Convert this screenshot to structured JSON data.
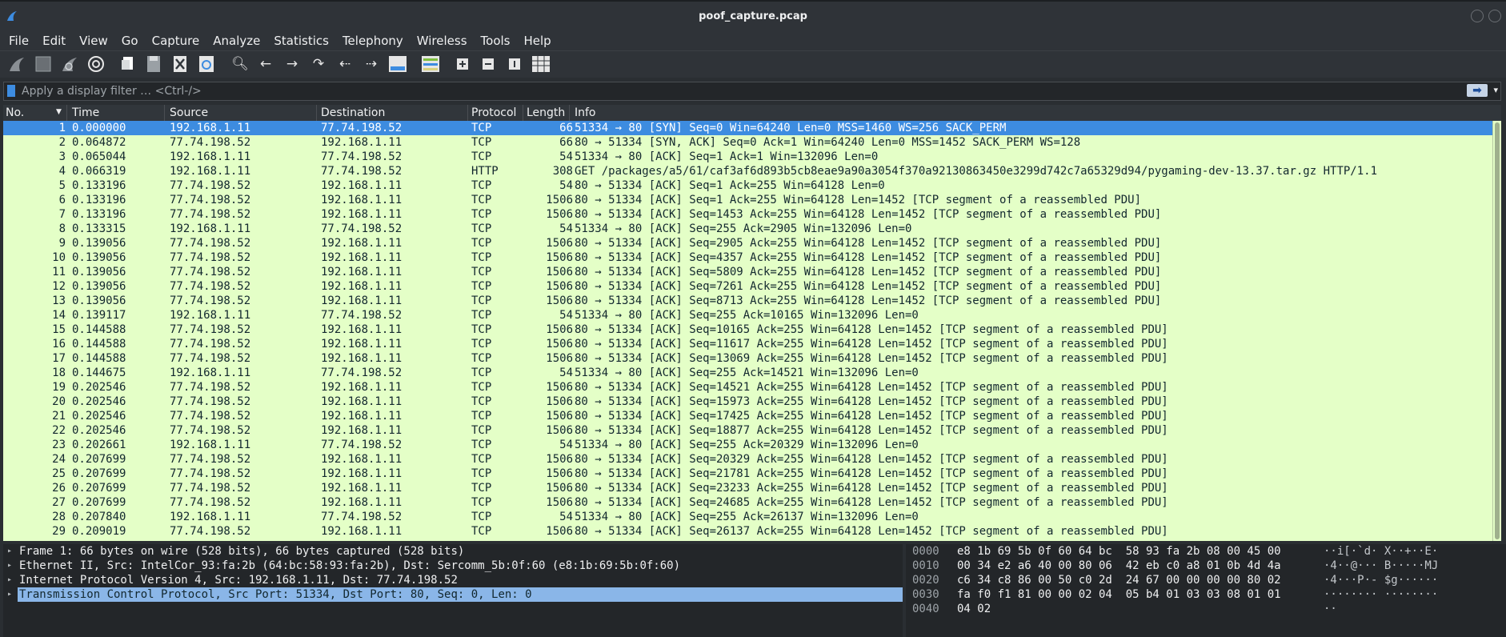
{
  "window": {
    "title": "poof_capture.pcap"
  },
  "menu": [
    "File",
    "Edit",
    "View",
    "Go",
    "Capture",
    "Analyze",
    "Statistics",
    "Telephony",
    "Wireless",
    "Tools",
    "Help"
  ],
  "toolbar_icons": [
    "shark-fin-start-icon",
    "stop-square-icon",
    "shark-fin-restart-icon",
    "options-gear-icon",
    "open-file-icon",
    "save-file-icon",
    "close-file-icon",
    "reload-file-icon",
    "search-icon",
    "back-arrow-icon",
    "forward-arrow-icon",
    "goto-packet-icon",
    "first-packet-icon",
    "last-packet-icon",
    "autoscroll-icon",
    "colorize-icon",
    "zoom-in-icon",
    "zoom-out-icon",
    "normal-size-icon",
    "resize-columns-icon"
  ],
  "filter": {
    "placeholder": "Apply a display filter … <Ctrl-/>",
    "value": ""
  },
  "columns": {
    "no": "No.",
    "time": "Time",
    "source": "Source",
    "destination": "Destination",
    "protocol": "Protocol",
    "length": "Length",
    "info": "Info"
  },
  "packets": [
    {
      "no": "1",
      "time": "0.000000",
      "src": "192.168.1.11",
      "dst": "77.74.198.52",
      "proto": "TCP",
      "len": "66",
      "info": "51334 → 80 [SYN] Seq=0 Win=64240 Len=0 MSS=1460 WS=256 SACK_PERM"
    },
    {
      "no": "2",
      "time": "0.064872",
      "src": "77.74.198.52",
      "dst": "192.168.1.11",
      "proto": "TCP",
      "len": "66",
      "info": "80 → 51334 [SYN, ACK] Seq=0 Ack=1 Win=64240 Len=0 MSS=1452 SACK_PERM WS=128"
    },
    {
      "no": "3",
      "time": "0.065044",
      "src": "192.168.1.11",
      "dst": "77.74.198.52",
      "proto": "TCP",
      "len": "54",
      "info": "51334 → 80 [ACK] Seq=1 Ack=1 Win=132096 Len=0"
    },
    {
      "no": "4",
      "time": "0.066319",
      "src": "192.168.1.11",
      "dst": "77.74.198.52",
      "proto": "HTTP",
      "len": "308",
      "info": "GET /packages/a5/61/caf3af6d893b5cb8eae9a90a3054f370a92130863450e3299d742c7a65329d94/pygaming-dev-13.37.tar.gz HTTP/1.1"
    },
    {
      "no": "5",
      "time": "0.133196",
      "src": "77.74.198.52",
      "dst": "192.168.1.11",
      "proto": "TCP",
      "len": "54",
      "info": "80 → 51334 [ACK] Seq=1 Ack=255 Win=64128 Len=0"
    },
    {
      "no": "6",
      "time": "0.133196",
      "src": "77.74.198.52",
      "dst": "192.168.1.11",
      "proto": "TCP",
      "len": "1506",
      "info": "80 → 51334 [ACK] Seq=1 Ack=255 Win=64128 Len=1452 [TCP segment of a reassembled PDU]"
    },
    {
      "no": "7",
      "time": "0.133196",
      "src": "77.74.198.52",
      "dst": "192.168.1.11",
      "proto": "TCP",
      "len": "1506",
      "info": "80 → 51334 [ACK] Seq=1453 Ack=255 Win=64128 Len=1452 [TCP segment of a reassembled PDU]"
    },
    {
      "no": "8",
      "time": "0.133315",
      "src": "192.168.1.11",
      "dst": "77.74.198.52",
      "proto": "TCP",
      "len": "54",
      "info": "51334 → 80 [ACK] Seq=255 Ack=2905 Win=132096 Len=0"
    },
    {
      "no": "9",
      "time": "0.139056",
      "src": "77.74.198.52",
      "dst": "192.168.1.11",
      "proto": "TCP",
      "len": "1506",
      "info": "80 → 51334 [ACK] Seq=2905 Ack=255 Win=64128 Len=1452 [TCP segment of a reassembled PDU]"
    },
    {
      "no": "10",
      "time": "0.139056",
      "src": "77.74.198.52",
      "dst": "192.168.1.11",
      "proto": "TCP",
      "len": "1506",
      "info": "80 → 51334 [ACK] Seq=4357 Ack=255 Win=64128 Len=1452 [TCP segment of a reassembled PDU]"
    },
    {
      "no": "11",
      "time": "0.139056",
      "src": "77.74.198.52",
      "dst": "192.168.1.11",
      "proto": "TCP",
      "len": "1506",
      "info": "80 → 51334 [ACK] Seq=5809 Ack=255 Win=64128 Len=1452 [TCP segment of a reassembled PDU]"
    },
    {
      "no": "12",
      "time": "0.139056",
      "src": "77.74.198.52",
      "dst": "192.168.1.11",
      "proto": "TCP",
      "len": "1506",
      "info": "80 → 51334 [ACK] Seq=7261 Ack=255 Win=64128 Len=1452 [TCP segment of a reassembled PDU]"
    },
    {
      "no": "13",
      "time": "0.139056",
      "src": "77.74.198.52",
      "dst": "192.168.1.11",
      "proto": "TCP",
      "len": "1506",
      "info": "80 → 51334 [ACK] Seq=8713 Ack=255 Win=64128 Len=1452 [TCP segment of a reassembled PDU]"
    },
    {
      "no": "14",
      "time": "0.139117",
      "src": "192.168.1.11",
      "dst": "77.74.198.52",
      "proto": "TCP",
      "len": "54",
      "info": "51334 → 80 [ACK] Seq=255 Ack=10165 Win=132096 Len=0"
    },
    {
      "no": "15",
      "time": "0.144588",
      "src": "77.74.198.52",
      "dst": "192.168.1.11",
      "proto": "TCP",
      "len": "1506",
      "info": "80 → 51334 [ACK] Seq=10165 Ack=255 Win=64128 Len=1452 [TCP segment of a reassembled PDU]"
    },
    {
      "no": "16",
      "time": "0.144588",
      "src": "77.74.198.52",
      "dst": "192.168.1.11",
      "proto": "TCP",
      "len": "1506",
      "info": "80 → 51334 [ACK] Seq=11617 Ack=255 Win=64128 Len=1452 [TCP segment of a reassembled PDU]"
    },
    {
      "no": "17",
      "time": "0.144588",
      "src": "77.74.198.52",
      "dst": "192.168.1.11",
      "proto": "TCP",
      "len": "1506",
      "info": "80 → 51334 [ACK] Seq=13069 Ack=255 Win=64128 Len=1452 [TCP segment of a reassembled PDU]"
    },
    {
      "no": "18",
      "time": "0.144675",
      "src": "192.168.1.11",
      "dst": "77.74.198.52",
      "proto": "TCP",
      "len": "54",
      "info": "51334 → 80 [ACK] Seq=255 Ack=14521 Win=132096 Len=0"
    },
    {
      "no": "19",
      "time": "0.202546",
      "src": "77.74.198.52",
      "dst": "192.168.1.11",
      "proto": "TCP",
      "len": "1506",
      "info": "80 → 51334 [ACK] Seq=14521 Ack=255 Win=64128 Len=1452 [TCP segment of a reassembled PDU]"
    },
    {
      "no": "20",
      "time": "0.202546",
      "src": "77.74.198.52",
      "dst": "192.168.1.11",
      "proto": "TCP",
      "len": "1506",
      "info": "80 → 51334 [ACK] Seq=15973 Ack=255 Win=64128 Len=1452 [TCP segment of a reassembled PDU]"
    },
    {
      "no": "21",
      "time": "0.202546",
      "src": "77.74.198.52",
      "dst": "192.168.1.11",
      "proto": "TCP",
      "len": "1506",
      "info": "80 → 51334 [ACK] Seq=17425 Ack=255 Win=64128 Len=1452 [TCP segment of a reassembled PDU]"
    },
    {
      "no": "22",
      "time": "0.202546",
      "src": "77.74.198.52",
      "dst": "192.168.1.11",
      "proto": "TCP",
      "len": "1506",
      "info": "80 → 51334 [ACK] Seq=18877 Ack=255 Win=64128 Len=1452 [TCP segment of a reassembled PDU]"
    },
    {
      "no": "23",
      "time": "0.202661",
      "src": "192.168.1.11",
      "dst": "77.74.198.52",
      "proto": "TCP",
      "len": "54",
      "info": "51334 → 80 [ACK] Seq=255 Ack=20329 Win=132096 Len=0"
    },
    {
      "no": "24",
      "time": "0.207699",
      "src": "77.74.198.52",
      "dst": "192.168.1.11",
      "proto": "TCP",
      "len": "1506",
      "info": "80 → 51334 [ACK] Seq=20329 Ack=255 Win=64128 Len=1452 [TCP segment of a reassembled PDU]"
    },
    {
      "no": "25",
      "time": "0.207699",
      "src": "77.74.198.52",
      "dst": "192.168.1.11",
      "proto": "TCP",
      "len": "1506",
      "info": "80 → 51334 [ACK] Seq=21781 Ack=255 Win=64128 Len=1452 [TCP segment of a reassembled PDU]"
    },
    {
      "no": "26",
      "time": "0.207699",
      "src": "77.74.198.52",
      "dst": "192.168.1.11",
      "proto": "TCP",
      "len": "1506",
      "info": "80 → 51334 [ACK] Seq=23233 Ack=255 Win=64128 Len=1452 [TCP segment of a reassembled PDU]"
    },
    {
      "no": "27",
      "time": "0.207699",
      "src": "77.74.198.52",
      "dst": "192.168.1.11",
      "proto": "TCP",
      "len": "1506",
      "info": "80 → 51334 [ACK] Seq=24685 Ack=255 Win=64128 Len=1452 [TCP segment of a reassembled PDU]"
    },
    {
      "no": "28",
      "time": "0.207840",
      "src": "192.168.1.11",
      "dst": "77.74.198.52",
      "proto": "TCP",
      "len": "54",
      "info": "51334 → 80 [ACK] Seq=255 Ack=26137 Win=132096 Len=0"
    },
    {
      "no": "29",
      "time": "0.209019",
      "src": "77.74.198.52",
      "dst": "192.168.1.11",
      "proto": "TCP",
      "len": "1506",
      "info": "80 → 51334 [ACK] Seq=26137 Ack=255 Win=64128 Len=1452 [TCP segment of a reassembled PDU]"
    }
  ],
  "details": [
    "Frame 1: 66 bytes on wire (528 bits), 66 bytes captured (528 bits)",
    "Ethernet II, Src: IntelCor_93:fa:2b (64:bc:58:93:fa:2b), Dst: Sercomm_5b:0f:60 (e8:1b:69:5b:0f:60)",
    "Internet Protocol Version 4, Src: 192.168.1.11, Dst: 77.74.198.52",
    "Transmission Control Protocol, Src Port: 51334, Dst Port: 80, Seq: 0, Len: 0"
  ],
  "bytes": [
    {
      "off": "0000",
      "hex": "e8 1b 69 5b 0f 60 64 bc  58 93 fa 2b 08 00 45 00",
      "ascii": "··i[·`d· X··+··E·"
    },
    {
      "off": "0010",
      "hex": "00 34 e2 a6 40 00 80 06  42 eb c0 a8 01 0b 4d 4a",
      "ascii": "·4··@··· B·····MJ"
    },
    {
      "off": "0020",
      "hex": "c6 34 c8 86 00 50 c0 2d  24 67 00 00 00 00 80 02",
      "ascii": "·4···P·- $g······"
    },
    {
      "off": "0030",
      "hex": "fa f0 f1 81 00 00 02 04  05 b4 01 03 03 08 01 01",
      "ascii": "········ ········"
    },
    {
      "off": "0040",
      "hex": "04 02",
      "ascii": "··"
    }
  ],
  "colors": {
    "packet_bg": "#e4ffc7",
    "selected": "#3d8ce0",
    "detail_selected": "#8ab6e8",
    "chrome": "#2f3338"
  }
}
